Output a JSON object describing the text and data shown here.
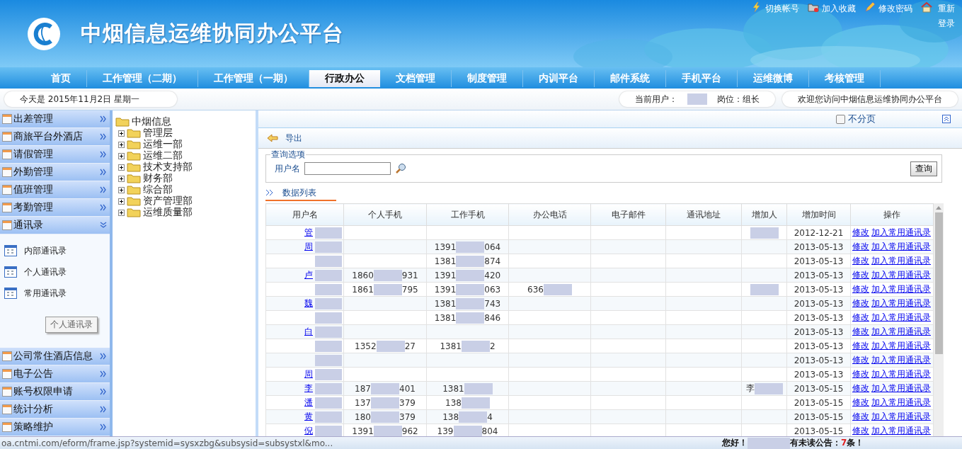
{
  "header": {
    "title": "中烟信息运维协同办公平台",
    "links": [
      {
        "label": "切换帐号"
      },
      {
        "label": "加入收藏"
      },
      {
        "label": "修改密码"
      },
      {
        "label": "重新登录"
      }
    ]
  },
  "nav": [
    {
      "label": "首页",
      "selected": false
    },
    {
      "label": "工作管理（二期）",
      "selected": false
    },
    {
      "label": "工作管理（一期）",
      "selected": false
    },
    {
      "label": "行政办公",
      "selected": true
    },
    {
      "label": "文档管理",
      "selected": false
    },
    {
      "label": "制度管理",
      "selected": false
    },
    {
      "label": "内训平台",
      "selected": false
    },
    {
      "label": "邮件系统",
      "selected": false
    },
    {
      "label": "手机平台",
      "selected": false
    },
    {
      "label": "运维微博",
      "selected": false
    },
    {
      "label": "考核管理",
      "selected": false
    }
  ],
  "info_bar": {
    "date": "今天是  2015年11月2日  星期一",
    "user_label": "当前用户：",
    "user_redacted": true,
    "position": "岗位：组长",
    "welcome": "欢迎您访问中烟信息运维协同办公平台"
  },
  "sidebar": [
    {
      "label": "出差管理",
      "expanded": false
    },
    {
      "label": "商旅平台外酒店",
      "expanded": false
    },
    {
      "label": "请假管理",
      "expanded": false
    },
    {
      "label": "外勤管理",
      "expanded": false
    },
    {
      "label": "值班管理",
      "expanded": false
    },
    {
      "label": "考勤管理",
      "expanded": false
    },
    {
      "label": "通讯录",
      "expanded": true,
      "children": [
        "内部通讯录",
        "个人通讯录",
        "常用通讯录"
      ],
      "tooltip": "个人通讯录"
    },
    {
      "label": "公司常住酒店信息",
      "expanded": false
    },
    {
      "label": "电子公告",
      "expanded": false
    },
    {
      "label": "账号权限申请",
      "expanded": false
    },
    {
      "label": "统计分析",
      "expanded": false
    },
    {
      "label": "策略维护",
      "expanded": false
    }
  ],
  "tree": {
    "label": "中烟信息",
    "children": [
      {
        "label": "管理层",
        "expanded": false
      },
      {
        "label": "运维一部",
        "expanded": false
      },
      {
        "label": "运维二部",
        "expanded": false
      },
      {
        "label": "技术支持部",
        "expanded": false
      },
      {
        "label": "财务部",
        "expanded": false
      },
      {
        "label": "综合部",
        "expanded": false
      },
      {
        "label": "资产管理部",
        "expanded": false
      },
      {
        "label": "运维质量部",
        "expanded": false
      }
    ]
  },
  "content": {
    "no_paging": {
      "label": "不分页",
      "checked": false
    },
    "export": "导出",
    "query": {
      "legend": "查询选项",
      "field_label": "用户名",
      "button": "查询"
    },
    "list_tab": "数据列表",
    "table": {
      "columns": [
        "用户名",
        "个人手机",
        "工作手机",
        "办公电话",
        "电子邮件",
        "通讯地址",
        "增加人",
        "增加时间",
        "操作"
      ],
      "rows": [
        {
          "name": {
            "start": "管",
            "redacted": true
          },
          "added_by": {
            "redacted": true
          },
          "date": "2012-12-21",
          "actions": [
            "修改",
            "加入常用通讯录"
          ]
        },
        {
          "name": {
            "start": "周",
            "redacted": true
          },
          "work": {
            "start": "1391",
            "redacted": true,
            "end": "064"
          },
          "date": "2013-05-13",
          "actions": [
            "修改",
            "加入常用通讯录"
          ]
        },
        {
          "name": {
            "redacted": true
          },
          "work": {
            "start": "1381",
            "redacted": true,
            "end": "874"
          },
          "date": "2013-05-13",
          "actions": [
            "修改",
            "加入常用通讯录"
          ]
        },
        {
          "name": {
            "start": "卢",
            "redacted": true
          },
          "personal": {
            "start": "1860",
            "redacted": true,
            "end": "931"
          },
          "work": {
            "start": "1391",
            "redacted": true,
            "end": "420"
          },
          "date": "2013-05-13",
          "actions": [
            "修改",
            "加入常用通讯录"
          ]
        },
        {
          "name": {
            "redacted": true
          },
          "personal": {
            "start": "1861",
            "redacted": true,
            "end": "795"
          },
          "work": {
            "start": "1391",
            "redacted": true,
            "end": "063"
          },
          "office": {
            "start": "636",
            "redacted": true
          },
          "added_by": {
            "redacted": true
          },
          "date": "2013-05-13",
          "actions": [
            "修改",
            "加入常用通讯录"
          ]
        },
        {
          "name": {
            "start": "魏",
            "redacted": true
          },
          "work": {
            "start": "1381",
            "redacted": true,
            "end": "743"
          },
          "date": "2013-05-13",
          "actions": [
            "修改",
            "加入常用通讯录"
          ]
        },
        {
          "name": {
            "redacted": true
          },
          "work": {
            "start": "1381",
            "redacted": true,
            "end": "846"
          },
          "date": "2013-05-13",
          "actions": [
            "修改",
            "加入常用通讯录"
          ]
        },
        {
          "name": {
            "start": "白",
            "redacted": true
          },
          "date": "2013-05-13",
          "actions": [
            "修改",
            "加入常用通讯录"
          ]
        },
        {
          "name": {
            "redacted": true
          },
          "personal": {
            "start": "1352",
            "redacted": true,
            "end": "27"
          },
          "work": {
            "start": "1381",
            "redacted": true,
            "end": "2"
          },
          "date": "2013-05-13",
          "actions": [
            "修改",
            "加入常用通讯录"
          ]
        },
        {
          "name": {
            "redacted": true
          },
          "date": "2013-05-13",
          "actions": [
            "修改",
            "加入常用通讯录"
          ]
        },
        {
          "name": {
            "start": "周",
            "redacted": true
          },
          "date": "2013-05-13",
          "actions": [
            "修改",
            "加入常用通讯录"
          ]
        },
        {
          "name": {
            "start": "李",
            "redacted": true
          },
          "personal": {
            "start": "187",
            "redacted": true,
            "end": "401"
          },
          "work": {
            "start": "1381",
            "redacted": true
          },
          "added_by": {
            "start": "李",
            "redacted": true
          },
          "date": "2013-05-15",
          "actions": [
            "修改",
            "加入常用通讯录"
          ]
        },
        {
          "name": {
            "start": "潘",
            "redacted": true
          },
          "personal": {
            "start": "137",
            "redacted": true,
            "end": "379"
          },
          "work": {
            "start": "138",
            "redacted": true
          },
          "date": "2013-05-15",
          "actions": [
            "修改",
            "加入常用通讯录"
          ]
        },
        {
          "name": {
            "start": "黄",
            "redacted": true
          },
          "personal": {
            "start": "180",
            "redacted": true,
            "end": "379"
          },
          "work": {
            "start": "138",
            "redacted": true,
            "end": "4"
          },
          "date": "2013-05-15",
          "actions": [
            "修改",
            "加入常用通讯录"
          ]
        },
        {
          "name": {
            "start": "倪",
            "redacted": true
          },
          "personal": {
            "start": "1391",
            "redacted": true,
            "end": "962"
          },
          "work": {
            "start": "139",
            "redacted": true,
            "end": "804"
          },
          "date": "2013-05-15",
          "actions": [
            "修改",
            "加入常用通讯录"
          ]
        }
      ]
    }
  },
  "status_bar": {
    "url": "oa.cntmi.com/eform/frame.jsp?systemid=sysxzbg&subsysid=subsystxl&mo...",
    "greeting": "您好！",
    "user_redacted": true,
    "notice_prefix": "有未读公告：",
    "notice_count": "7",
    "notice_suffix": "条！"
  }
}
